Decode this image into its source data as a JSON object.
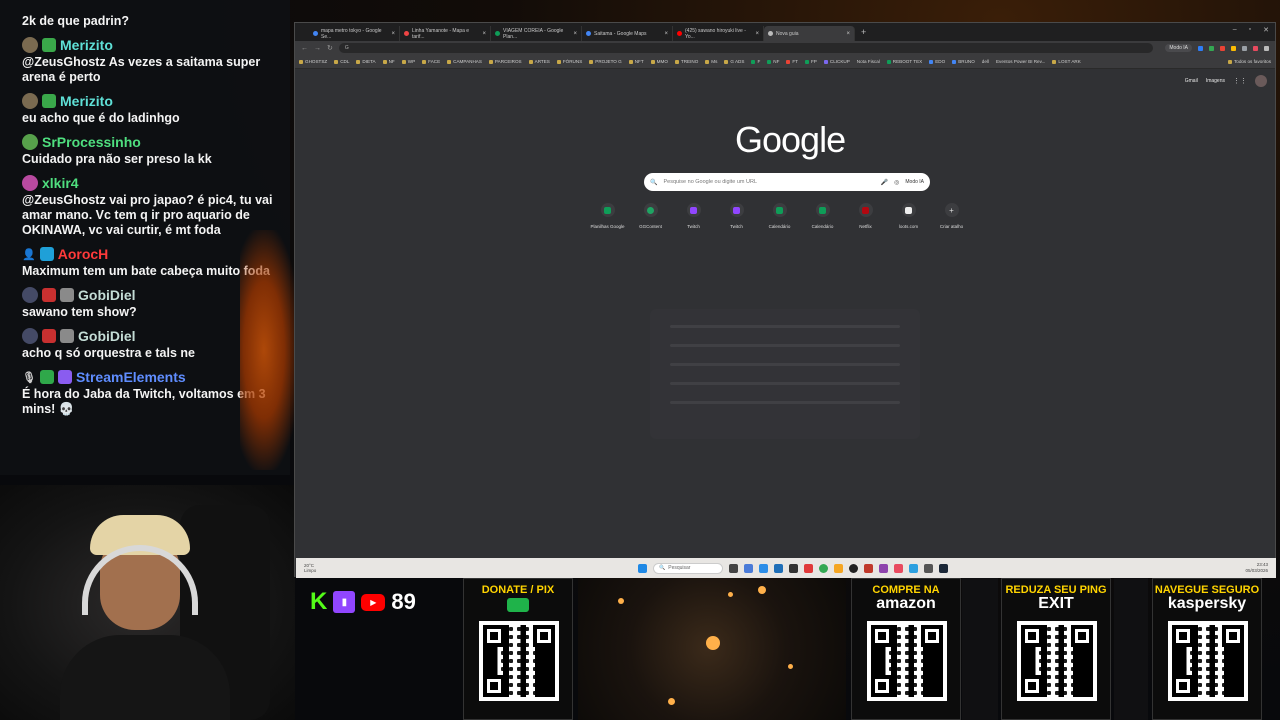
{
  "chat": {
    "messages": [
      {
        "user": "",
        "text": "2k de que padrin?",
        "color": "#ffffff"
      },
      {
        "user": "Merizito",
        "text": "@ZeusGhostz As vezes a saitama super arena é perto",
        "color": "#5fe0d7"
      },
      {
        "user": "Merizito",
        "text": "eu acho que é do ladinhgo",
        "color": "#5fe0d7"
      },
      {
        "user": "SrProcessinho",
        "text": "Cuidado pra não ser preso la kk",
        "color": "#4fdf7f"
      },
      {
        "user": "xlkir4",
        "text": "@ZeusGhostz vai pro japao? é pic4, tu vai amar mano. Vc tem q ir pro aquario de OKINAWA, vc vai curtir, é mt foda",
        "color": "#4fdf7f"
      },
      {
        "user": "AorocH",
        "text": "Maximum tem um bate cabeça muito foda",
        "color": "#ff3a3a"
      },
      {
        "user": "GobiDiel",
        "text": "sawano tem show?",
        "color": "#c4ddd6"
      },
      {
        "user": "GobiDiel",
        "text": "acho q só orquestra e tals ne",
        "color": "#c4ddd6"
      },
      {
        "user": "StreamElements",
        "text": "É hora do Jaba da Twitch, voltamos em 3 mins! 💀",
        "color": "#5f8dff"
      }
    ]
  },
  "browser": {
    "tabs": [
      {
        "label": "mapa metro tokyo - Google Se...",
        "color": "#4285f4",
        "active": false
      },
      {
        "label": "Linha Yamanote - Mapa e tarif...",
        "color": "#e44",
        "active": false
      },
      {
        "label": "VIAGEM COREIA - Google Plan...",
        "color": "#0f9d58",
        "active": false
      },
      {
        "label": "Saitama - Google Maps",
        "color": "#4285f4",
        "active": false
      },
      {
        "label": "(425) sawano hiroyuki live - Yo...",
        "color": "#ff0000",
        "active": false
      },
      {
        "label": "Nova guia",
        "color": "#bbbbbb",
        "active": true
      }
    ],
    "new_tab": "+",
    "omnibox_icon": "G",
    "ai_mode": "Modo IA",
    "bookmarks": [
      "GHOSTSZ",
      "CDL",
      "DIETA",
      "NF",
      "WP",
      "FACE",
      "CAMPANHAS",
      "PARCEIROS",
      "ARTES",
      "FÓRUNS",
      "PROJETO G",
      "NFT",
      "MMO",
      "TREINO",
      "Ms",
      "G ADS",
      "F",
      "NF",
      "FT",
      "FP",
      "CLICKUP",
      "Nota Fiscal",
      "REBOOT TEX",
      "EDO",
      "BRUNO",
      "dell",
      "Eventos Power BI Rev...",
      "LOST ARK"
    ],
    "all_bookmarks": "Todos os favoritos",
    "top_links": {
      "gmail": "Gmail",
      "images": "Imagens"
    },
    "logo": "Google",
    "search_placeholder": "Pesquise no Google ou digite um URL",
    "search_ai_mode": "Modo IA",
    "shortcuts": [
      {
        "label": "Planilhas Google",
        "color": "#0f9d58"
      },
      {
        "label": "GGContent",
        "color": "#1fa463"
      },
      {
        "label": "Twitch",
        "color": "#9146ff"
      },
      {
        "label": "Twitch",
        "color": "#9146ff"
      },
      {
        "label": "Calendário",
        "color": "#0f9d58"
      },
      {
        "label": "Calendário",
        "color": "#0f9d58"
      },
      {
        "label": "Netflix",
        "color": "#b20710"
      },
      {
        "label": "loots.com",
        "color": "#eeeeee"
      },
      {
        "label": "Criar atalho",
        "color": "#3c3d40"
      }
    ],
    "customize": "Personalizar o Chrome"
  },
  "taskbar": {
    "weather": "20°C\nLimpo",
    "search": "Pesquisar",
    "time": "23:43",
    "date": "05/03/2026"
  },
  "overlay": {
    "kick": "K",
    "viewers": "89",
    "cards": [
      {
        "title": "DONATE / PIX",
        "brand": "",
        "title_color": "#ffd400"
      },
      {
        "title": "COMPRE NA",
        "brand": "amazon",
        "title_color": "#ffd400"
      },
      {
        "title": "REDUZA SEU PING",
        "brand": "EXIT",
        "title_color": "#ffd400"
      },
      {
        "title": "NAVEGUE SEGURO",
        "brand": "kaspersky",
        "title_color": "#ffd400"
      }
    ]
  }
}
